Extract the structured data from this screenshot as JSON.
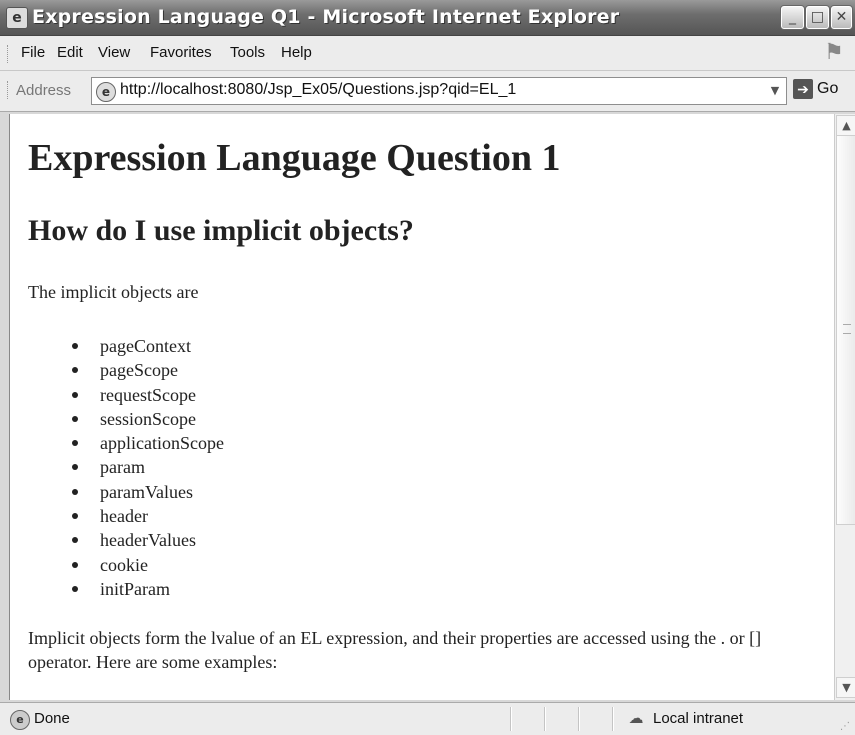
{
  "window": {
    "title": "Expression Language Q1 - Microsoft Internet Explorer",
    "icon": "ie-page-icon",
    "controls": {
      "minimize": "_",
      "maximize": "□",
      "close": "✕"
    }
  },
  "menu": {
    "items": [
      {
        "label": "File"
      },
      {
        "label": "Edit"
      },
      {
        "label": "View"
      },
      {
        "label": "Favorites"
      },
      {
        "label": "Tools"
      },
      {
        "label": "Help"
      }
    ]
  },
  "address": {
    "label": "Address",
    "url": "http://localhost:8080/Jsp_Ex05/Questions.jsp?qid=EL_1",
    "go_label": "Go"
  },
  "page": {
    "heading": "Expression Language Question 1",
    "subheading": "How do I use implicit objects?",
    "intro": "The implicit objects are",
    "objects": [
      "pageContext",
      "pageScope",
      "requestScope",
      "sessionScope",
      "applicationScope",
      "param",
      "paramValues",
      "header",
      "headerValues",
      "cookie",
      "initParam"
    ],
    "paragraph": "Implicit objects form the lvalue of an EL expression, and their properties are accessed using the . or [] operator. Here are some examples:"
  },
  "status": {
    "text": "Done",
    "zone": "Local intranet"
  }
}
